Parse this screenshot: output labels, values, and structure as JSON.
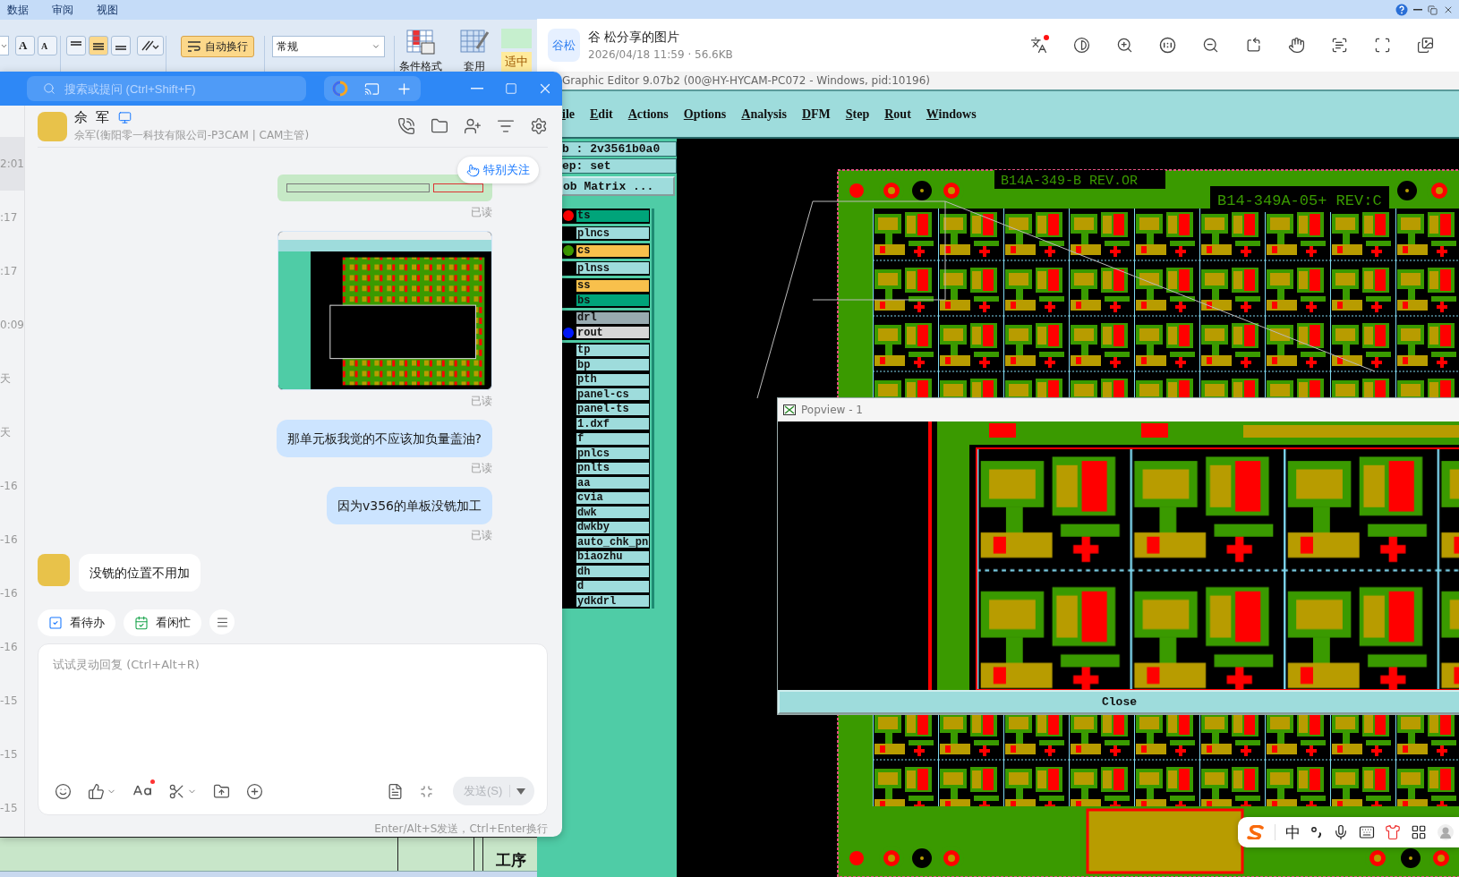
{
  "excel": {
    "menu": [
      "数据",
      "审阅",
      "视图"
    ],
    "font_buttons": [
      "A",
      "A"
    ],
    "align_buttons": [
      {
        "selected": false
      },
      {
        "selected": true
      },
      {
        "selected": false
      }
    ],
    "wrap_button": {
      "label": "自动换行",
      "on": true
    },
    "number_format": "常规",
    "conditional_format": "条件格式",
    "table_style": "套用",
    "style_cell": "适中",
    "cell_text": "工序"
  },
  "chat": {
    "search_placeholder": "搜索或提问 (Ctrl+Shift+F)",
    "times": [
      {
        "label": "2:01",
        "selected": true
      },
      {
        "label": ":17",
        "selected": false
      },
      {
        "label": ":17",
        "selected": false
      },
      {
        "label": "0:09",
        "selected": false
      },
      {
        "label": "天",
        "selected": false
      },
      {
        "label": "天",
        "selected": false
      },
      {
        "label": "-16",
        "selected": false
      },
      {
        "label": "-16",
        "selected": false
      },
      {
        "label": "-16",
        "selected": false
      },
      {
        "label": "-16",
        "selected": false
      },
      {
        "label": "-15",
        "selected": false
      },
      {
        "label": "-15",
        "selected": false
      },
      {
        "label": "-15",
        "selected": false
      }
    ],
    "contact": {
      "name": "佘 军",
      "subtitle": "佘军(衡阳零一科技有限公司-P3CAM | CAM主管)"
    },
    "follow_button": "特别关注",
    "messages": [
      {
        "kind": "sheet_image",
        "outgoing": true,
        "status": "已读"
      },
      {
        "kind": "screenshot",
        "outgoing": true,
        "status": "已读"
      },
      {
        "kind": "text",
        "outgoing": true,
        "text": "那单元板我觉的不应该加负量盖油?",
        "status": "已读"
      },
      {
        "kind": "text",
        "outgoing": true,
        "text": "因为v356的单板没铣加工",
        "status": "已读"
      },
      {
        "kind": "text",
        "outgoing": false,
        "text": "没铣的位置不用加"
      }
    ],
    "chips": [
      {
        "kind": "todo",
        "label": "看待办"
      },
      {
        "kind": "calendar",
        "label": "看闲忙"
      }
    ],
    "input_placeholder": "试试灵动回复 (Ctrl+Alt+R)",
    "send_button": {
      "label": "发送(S)",
      "disabled": true
    },
    "hint": "Enter/Alt+S发送，Ctrl+Enter换行"
  },
  "viewer": {
    "logo": "谷松",
    "title": "谷 松分享的图片",
    "meta": "2026/04/18 11:59 · 56.6KB"
  },
  "cam": {
    "title": "Graphic Editor 9.07b2 (00@HY-HYCAM-PC072 - Windows, pid:10196)",
    "menu": [
      "ile",
      "Edit",
      "Actions",
      "Options",
      "Analysis",
      "DFM",
      "Step",
      "Rout",
      "Windows"
    ],
    "job": "b : 2v3561b0a0",
    "step": "ep: set",
    "matrix_button": "ob Matrix ...",
    "layer_groups": [
      {
        "layers": [
          {
            "name": "ts",
            "color": "#00a47a",
            "dot": {
              "color": "#ff0000"
            }
          }
        ]
      },
      {
        "layers": [
          {
            "name": "plncs",
            "color": "#9edcdc"
          }
        ]
      },
      {
        "layers": [
          {
            "name": "cs",
            "color": "#f8c04c",
            "dot": {
              "color": "#3c9a00"
            }
          }
        ]
      },
      {
        "layers": [
          {
            "name": "plnss",
            "color": "#9edcdc"
          }
        ]
      },
      {
        "layers": [
          {
            "name": "ss",
            "color": "#f8c04c"
          },
          {
            "name": "bs",
            "color": "#00a47a"
          }
        ]
      },
      {
        "layers": [
          {
            "name": "drl",
            "color": "#98aab0"
          },
          {
            "name": "rout",
            "color": "#d6d6d6",
            "dot": {
              "color": "#0018ff"
            }
          }
        ]
      },
      {
        "layers": [
          {
            "name": "tp",
            "color": "#9edcdc"
          },
          {
            "name": "bp",
            "color": "#9edcdc"
          },
          {
            "name": "pth",
            "color": "#9edcdc"
          },
          {
            "name": "panel-cs",
            "color": "#9edcdc"
          },
          {
            "name": "panel-ts",
            "color": "#9edcdc"
          },
          {
            "name": "1.dxf",
            "color": "#9edcdc"
          },
          {
            "name": "f",
            "color": "#9edcdc"
          },
          {
            "name": "pnlcs",
            "color": "#9edcdc"
          },
          {
            "name": "pnlts",
            "color": "#9edcdc"
          },
          {
            "name": "aa",
            "color": "#9edcdc"
          },
          {
            "name": "cvia",
            "color": "#9edcdc"
          },
          {
            "name": "dwk",
            "color": "#9edcdc"
          },
          {
            "name": "dwkby",
            "color": "#9edcdc"
          },
          {
            "name": "auto_chk_pn",
            "color": "#9edcdc"
          },
          {
            "name": "biaozhu",
            "color": "#9edcdc"
          },
          {
            "name": "dh",
            "color": "#9edcdc"
          },
          {
            "name": "d",
            "color": "#9edcdc"
          },
          {
            "name": "ydkdrl",
            "color": "#9edcdc"
          }
        ]
      }
    ],
    "board_labels": [
      "B14A-349-B REV.OR",
      "B14-349A-05+ REV:C"
    ],
    "popview": {
      "title": "Popview - 1",
      "close": "Close"
    }
  },
  "ime": {
    "mode": "中"
  }
}
